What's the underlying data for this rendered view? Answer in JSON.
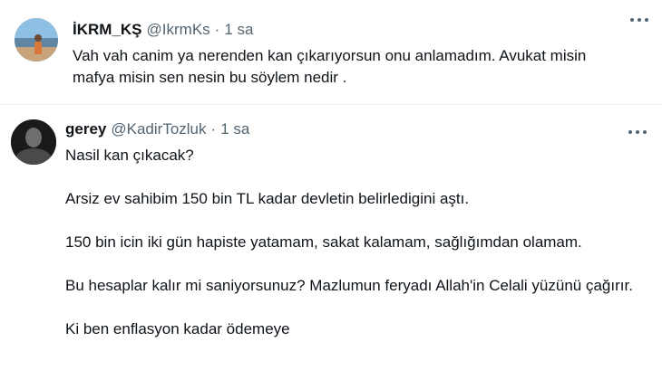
{
  "tweets": [
    {
      "name": "İKRM_KŞ",
      "handle": "@IkrmKs",
      "separator": "·",
      "time": "1 sa",
      "text": [
        "Vah vah canim ya nerenden kan çıkarıyorsun onu anlamadım.  Avukat misin",
        "mafya misin sen nesin bu söylem nedir ."
      ]
    },
    {
      "name": "gerey",
      "handle": "@KadirTozluk",
      "separator": "·",
      "time": "1 sa",
      "paragraphs": [
        "Nasil kan çıkacak?",
        "Arsiz ev sahibim 150 bin TL kadar devletin belirledigini aştı.",
        "150 bin icin iki gün hapiste yatamam, sakat kalamam, sağlığımdan olamam.",
        "Bu hesaplar kalır mi saniyorsunuz? Mazlumun feryadı Allah'in Celali yüzünü çağırır.",
        "Ki ben enflasyon kadar ödemeye"
      ]
    }
  ]
}
